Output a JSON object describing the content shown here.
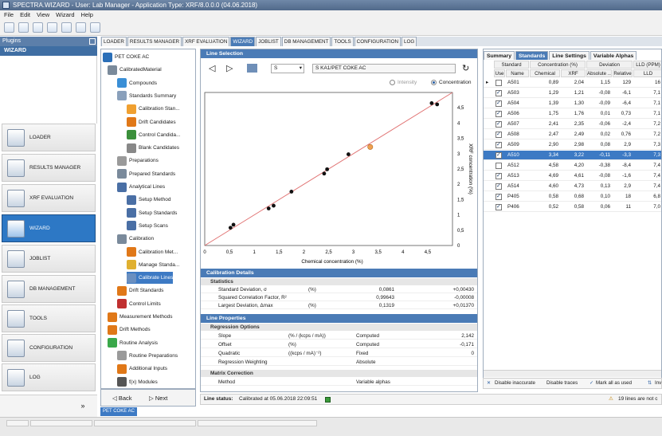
{
  "window": {
    "title": "SPECTRA.WIZARD - User: Lab Manager - Application Type: XRF/8.0.0.0 (04.06.2018)"
  },
  "menu": [
    "File",
    "Edit",
    "View",
    "Wizard",
    "Help"
  ],
  "plugins": {
    "header": "Plugins",
    "panel_title": "WIZARD",
    "items": [
      {
        "label": "LOADER",
        "icon": "loader-icon"
      },
      {
        "label": "RESULTS MANAGER",
        "icon": "results-manager-icon"
      },
      {
        "label": "XRF EVALUATION",
        "icon": "xrf-evaluation-icon"
      },
      {
        "label": "WIZARD",
        "icon": "wizard-icon",
        "active": true
      },
      {
        "label": "JOBLIST",
        "icon": "joblist-icon"
      },
      {
        "label": "DB MANAGEMENT",
        "icon": "db-management-icon"
      },
      {
        "label": "TOOLS",
        "icon": "tools-icon"
      },
      {
        "label": "CONFIGURATION",
        "icon": "configuration-icon"
      },
      {
        "label": "LOG",
        "icon": "log-icon"
      }
    ]
  },
  "tabs": [
    "LOADER",
    "RESULTS MANAGER",
    "XRF EVALUATION",
    "WIZARD",
    "JOBLIST",
    "DB MANAGEMENT",
    "TOOLS",
    "CONFIGURATION",
    "LOG"
  ],
  "active_tab": "WIZARD",
  "tree": {
    "items": [
      {
        "label": "PET COKE AC",
        "color": "#2b6fb8"
      },
      {
        "label": "CalibratedMaterial",
        "color": "#7a8a9b"
      },
      {
        "label": "Compounds",
        "color": "#3a8fd6"
      },
      {
        "label": "Standards Summary",
        "color": "#8aa0bb"
      },
      {
        "label": "Calibration Stan...",
        "color": "#f0a030"
      },
      {
        "label": "Drift Candidates",
        "color": "#e07818"
      },
      {
        "label": "Control Candida...",
        "color": "#3b8f3b"
      },
      {
        "label": "Blank Candidates",
        "color": "#888888"
      },
      {
        "label": "Preparations",
        "color": "#9a9a9a"
      },
      {
        "label": "Prepared Standards",
        "color": "#7a8a9b"
      },
      {
        "label": "Analytical Lines",
        "color": "#4a6fa5"
      },
      {
        "label": "Setup Method",
        "color": "#4a6fa5"
      },
      {
        "label": "Setup Standards",
        "color": "#4a6fa5"
      },
      {
        "label": "Setup Scans",
        "color": "#4a6fa5"
      },
      {
        "label": "Calibration",
        "color": "#7a8a9b"
      },
      {
        "label": "Calibration Met...",
        "color": "#e07818"
      },
      {
        "label": "Manage Standa...",
        "color": "#e0b030"
      },
      {
        "label": "Calibrate Lines",
        "color": "#6a8fc0",
        "selected": true
      },
      {
        "label": "Drift Standards",
        "color": "#e07818"
      },
      {
        "label": "Control Limits",
        "color": "#c03030"
      },
      {
        "label": "Measurement Methods",
        "color": "#e07818"
      },
      {
        "label": "Drift Methods",
        "color": "#e07818"
      },
      {
        "label": "Routine Analysis",
        "color": "#3aa84a"
      },
      {
        "label": "Routine Preparations",
        "color": "#9a9a9a"
      },
      {
        "label": "Additional Inputs",
        "color": "#e07818"
      },
      {
        "label": "f(x) Modules",
        "color": "#555555"
      }
    ],
    "back_label": "Back",
    "next_label": "Next",
    "breadcrumb": "PET COKE AC"
  },
  "line_selection": {
    "header": "Line Selection",
    "element": "S",
    "line": "S KA1/PET COKE AC",
    "radio_intensity": "Intensity",
    "radio_concentration": "Concentration",
    "selected_radio": "Concentration"
  },
  "chart_data": {
    "type": "scatter",
    "xlabel": "Chemical concentration (%)",
    "ylabel": "XRF concentration (%)",
    "xlim": [
      0,
      5
    ],
    "ylim": [
      0,
      5
    ],
    "xticks": [
      "0",
      "0,5",
      "1",
      "1,5",
      "2",
      "2,5",
      "3",
      "3,5",
      "4",
      "4,5"
    ],
    "yticks": [
      "0",
      "0,5",
      "1",
      "1,5",
      "2",
      "2,5",
      "3",
      "3,5",
      "4",
      "4,5"
    ],
    "fit_line": {
      "x": [
        0,
        5
      ],
      "y": [
        0,
        5
      ],
      "color": "#e07070"
    },
    "points": [
      {
        "x": 0.52,
        "y": 0.58
      },
      {
        "x": 0.58,
        "y": 0.68
      },
      {
        "x": 1.29,
        "y": 1.21
      },
      {
        "x": 1.39,
        "y": 1.3
      },
      {
        "x": 1.75,
        "y": 1.76
      },
      {
        "x": 2.41,
        "y": 2.35
      },
      {
        "x": 2.47,
        "y": 2.49
      },
      {
        "x": 2.9,
        "y": 2.98
      },
      {
        "x": 4.58,
        "y": 4.65
      },
      {
        "x": 4.69,
        "y": 4.61
      }
    ],
    "highlight_point": {
      "x": 3.34,
      "y": 3.22,
      "color": "#f0a050"
    }
  },
  "calibration_details": {
    "header": "Calibration Details",
    "statistics_header": "Statistics",
    "rows": [
      {
        "label": "Standard Deviation, σ",
        "unit": "(%)",
        "value": "0,0861",
        "extra": "+0,00430"
      },
      {
        "label": "Squared Correlation Factor, R²",
        "unit": "",
        "value": "0,99643",
        "extra": "-0,00008"
      },
      {
        "label": "Largest Deviation, Δmax",
        "unit": "(%)",
        "value": "0,1319",
        "extra": "+0,01370"
      }
    ]
  },
  "line_properties": {
    "header": "Line Properties",
    "regression_header": "Regression Options",
    "rows": [
      {
        "label": "Slope",
        "unit": "(% / (kcps / mA))",
        "mode": "Computed",
        "value": "2,142"
      },
      {
        "label": "Offset",
        "unit": "(%)",
        "mode": "Computed",
        "value": "-0,171"
      },
      {
        "label": "Quadratic",
        "unit": "((kcps / mA)⁻²)",
        "mode": "Fixed",
        "value": "0"
      },
      {
        "label": "Regression Weighting",
        "unit": "",
        "mode": "Absolute",
        "value": ""
      }
    ],
    "matrix_header": "Matrix Correction",
    "matrix_rows": [
      {
        "label": "Method",
        "value": "Variable alphas"
      }
    ]
  },
  "status_line": {
    "label": "Line status:",
    "text": "Calibrated at 05.06.2018 22:09:51",
    "warning": "19 lines are not c"
  },
  "right_panel": {
    "tabs": [
      "Summary",
      "Standards",
      "Line Settings",
      "Variable Alphas"
    ],
    "active_tab": "Standards",
    "group_headers": [
      "Standard",
      "Concentration (%)",
      "Deviation",
      "LLD (PPM)"
    ],
    "columns": [
      "Use",
      "Name",
      "Chemical",
      "XRF",
      "Absolute ...",
      "Relative",
      "LLD"
    ],
    "rows": [
      {
        "use": false,
        "name": "A501",
        "chemical": "0,89",
        "xrf": "2,04",
        "absolute": "1,15",
        "relative": "129",
        "lld": "16",
        "current": true
      },
      {
        "use": true,
        "name": "A503",
        "chemical": "1,29",
        "xrf": "1,21",
        "absolute": "-0,08",
        "relative": "-6,1",
        "lld": "7,1"
      },
      {
        "use": true,
        "name": "A504",
        "chemical": "1,39",
        "xrf": "1,30",
        "absolute": "-0,09",
        "relative": "-6,4",
        "lld": "7,1"
      },
      {
        "use": true,
        "name": "A506",
        "chemical": "1,75",
        "xrf": "1,76",
        "absolute": "0,01",
        "relative": "0,73",
        "lld": "7,1"
      },
      {
        "use": true,
        "name": "A507",
        "chemical": "2,41",
        "xrf": "2,35",
        "absolute": "-0,06",
        "relative": "-2,4",
        "lld": "7,2"
      },
      {
        "use": true,
        "name": "A508",
        "chemical": "2,47",
        "xrf": "2,49",
        "absolute": "0,02",
        "relative": "0,76",
        "lld": "7,2"
      },
      {
        "use": true,
        "name": "A509",
        "chemical": "2,90",
        "xrf": "2,98",
        "absolute": "0,08",
        "relative": "2,9",
        "lld": "7,3"
      },
      {
        "use": true,
        "name": "A510",
        "chemical": "3,34",
        "xrf": "3,22",
        "absolute": "-0,11",
        "relative": "-3,3",
        "lld": "7,3",
        "selected": true
      },
      {
        "use": false,
        "name": "A512",
        "chemical": "4,58",
        "xrf": "4,20",
        "absolute": "-0,38",
        "relative": "-8,4",
        "lld": "7,4"
      },
      {
        "use": true,
        "name": "A513",
        "chemical": "4,69",
        "xrf": "4,61",
        "absolute": "-0,08",
        "relative": "-1,6",
        "lld": "7,4"
      },
      {
        "use": true,
        "name": "A514",
        "chemical": "4,60",
        "xrf": "4,73",
        "absolute": "0,13",
        "relative": "2,9",
        "lld": "7,4"
      },
      {
        "use": true,
        "name": "P405",
        "chemical": "0,58",
        "xrf": "0,68",
        "absolute": "0,10",
        "relative": "18",
        "lld": "6,8"
      },
      {
        "use": true,
        "name": "P406",
        "chemical": "0,52",
        "xrf": "0,58",
        "absolute": "0,06",
        "relative": "11",
        "lld": "7,0"
      }
    ],
    "footer": {
      "disable_inaccurate": "Disable inaccurate",
      "disable_traces": "Disable traces",
      "mark_all": "Mark all as used",
      "invert": "Inv"
    }
  }
}
